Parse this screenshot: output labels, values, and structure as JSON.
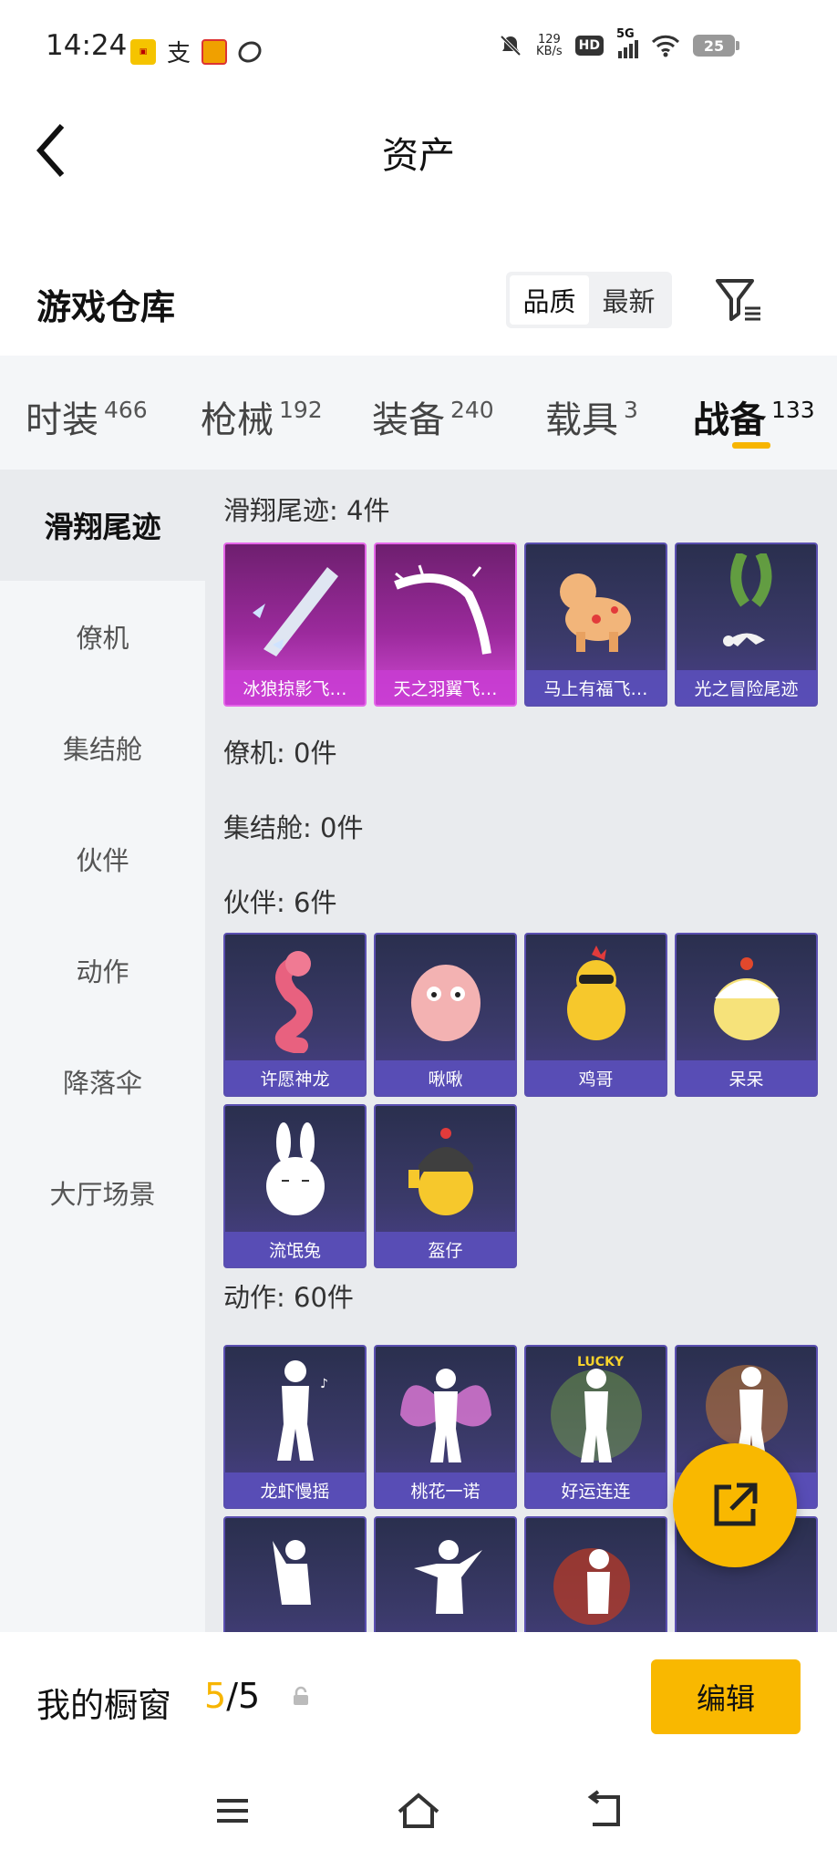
{
  "status_bar": {
    "time": "14:24",
    "net_speed_value": "129",
    "net_speed_unit": "KB/s",
    "hd": "HD",
    "signal": "5G",
    "battery": "25"
  },
  "header": {
    "title": "资产"
  },
  "section": {
    "title": "游戏仓库",
    "sort_quality": "品质",
    "sort_latest": "最新"
  },
  "tabs": [
    {
      "label": "时装",
      "count": "466"
    },
    {
      "label": "枪械",
      "count": "192"
    },
    {
      "label": "装备",
      "count": "240"
    },
    {
      "label": "载具",
      "count": "3"
    },
    {
      "label": "战备",
      "count": "133"
    }
  ],
  "sidebar": {
    "items": [
      {
        "label": "滑翔尾迹"
      },
      {
        "label": "僚机"
      },
      {
        "label": "集结舱"
      },
      {
        "label": "伙伴"
      },
      {
        "label": "动作"
      },
      {
        "label": "降落伞"
      },
      {
        "label": "大厅场景"
      }
    ]
  },
  "groups": {
    "glide": {
      "label": "滑翔尾迹: 4件",
      "items": [
        "冰狼掠影飞…",
        "天之羽翼飞…",
        "马上有福飞…",
        "光之冒险尾迹"
      ]
    },
    "wingman": {
      "label": "僚机: 0件"
    },
    "pod": {
      "label": "集结舱: 0件"
    },
    "partner": {
      "label": "伙伴: 6件",
      "items": [
        "许愿神龙",
        "啾啾",
        "鸡哥",
        "呆呆",
        "流氓兔",
        "盔仔"
      ]
    },
    "emote": {
      "label": "动作: 60件",
      "items": [
        "龙虾慢摇",
        "桃花一诺",
        "好运连连",
        ""
      ]
    }
  },
  "bottom": {
    "my_window": "我的橱窗",
    "count_current": "5",
    "count_total": "/5",
    "edit": "编辑"
  },
  "colors": {
    "accent": "#f9b800",
    "card_purple": "#3b3a6a",
    "card_pink": "#9b2a9c"
  }
}
